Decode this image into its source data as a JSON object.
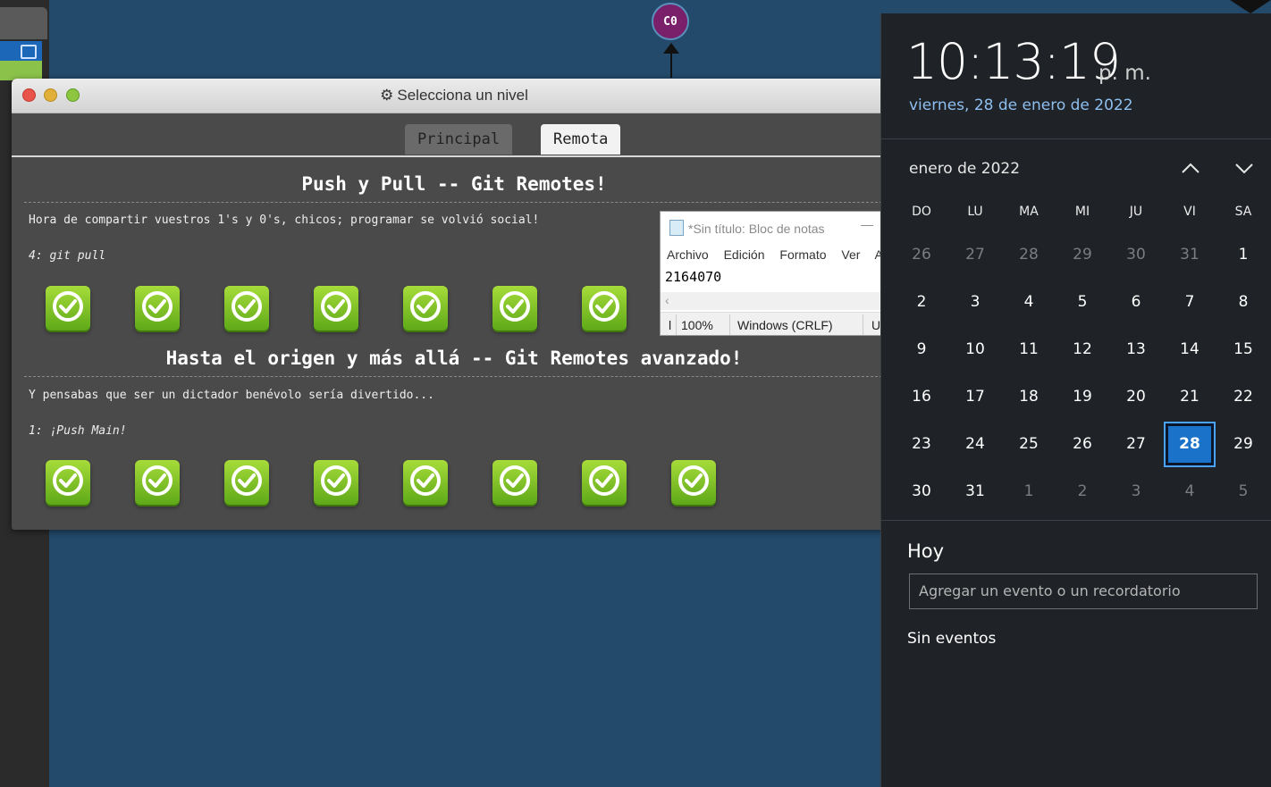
{
  "commit": {
    "label": "C0"
  },
  "dialog": {
    "title": "Selecciona un nivel",
    "tabs": [
      {
        "label": "Principal"
      },
      {
        "label": "Remota"
      }
    ],
    "sections": [
      {
        "title": "Push y Pull -- Git Remotes!",
        "description": "Hora de compartir vuestros 1's y 0's, chicos; programar se volvió social!",
        "current_level": "4: git pull",
        "completed_levels": 7
      },
      {
        "title": "Hasta el origen y más allá -- Git Remotes avanzado!",
        "description": "Y pensabas que ser un dictador benévolo sería divertido...",
        "current_level": "1: ¡Push Main!",
        "completed_levels": 8
      }
    ]
  },
  "notepad": {
    "title": "*Sin título: Bloc de notas",
    "menu": [
      "Archivo",
      "Edición",
      "Formato",
      "Ver",
      "A"
    ],
    "content": "2164070",
    "status": {
      "pos": "l",
      "zoom": "100%",
      "eol": "Windows (CRLF)",
      "enc": "U"
    }
  },
  "calendar": {
    "time": "10:13:19",
    "ampm": "p. m.",
    "date": "viernes, 28 de enero de 2022",
    "month": "enero de 2022",
    "weekdays": [
      "DO",
      "LU",
      "MA",
      "MI",
      "JU",
      "VI",
      "SA"
    ],
    "weeks": [
      [
        "26",
        "27",
        "28",
        "29",
        "30",
        "31",
        "1"
      ],
      [
        "2",
        "3",
        "4",
        "5",
        "6",
        "7",
        "8"
      ],
      [
        "9",
        "10",
        "11",
        "12",
        "13",
        "14",
        "15"
      ],
      [
        "16",
        "17",
        "18",
        "19",
        "20",
        "21",
        "22"
      ],
      [
        "23",
        "24",
        "25",
        "26",
        "27",
        "28",
        "29"
      ],
      [
        "30",
        "31",
        "1",
        "2",
        "3",
        "4",
        "5"
      ]
    ],
    "today": "28",
    "today_label": "Hoy",
    "event_placeholder": "Agregar un evento o un recordatorio",
    "no_events": "Sin eventos"
  }
}
